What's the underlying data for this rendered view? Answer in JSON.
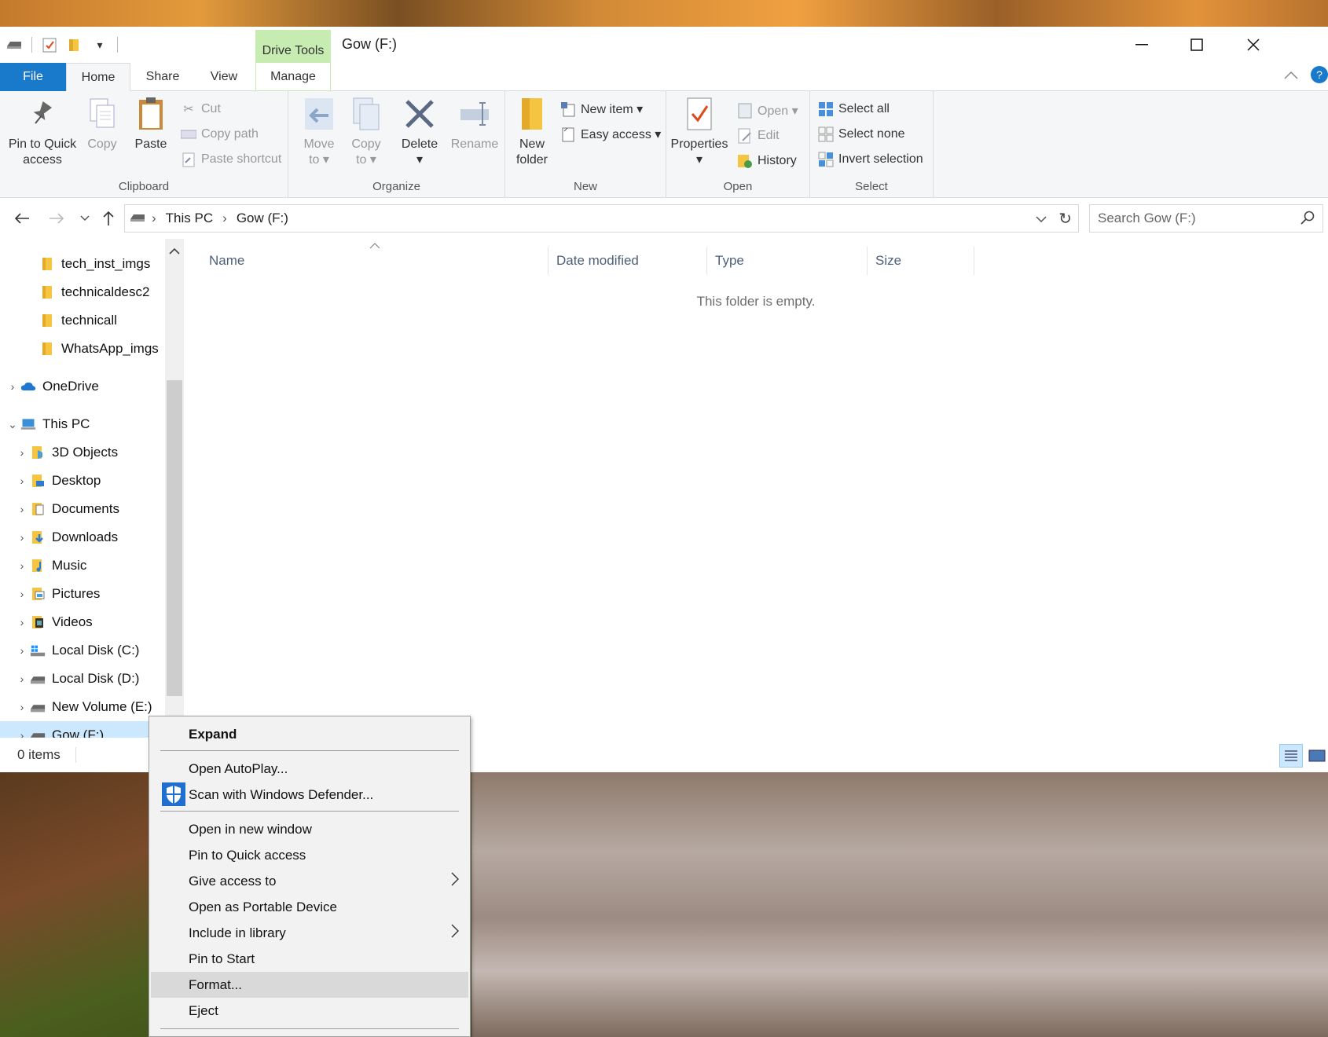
{
  "window": {
    "title": "Gow (F:)",
    "drive_tools_label": "Drive Tools",
    "controls": {
      "minimize": "—",
      "maximize": "☐",
      "close": "✕"
    }
  },
  "tabs": {
    "file": "File",
    "home": "Home",
    "share": "Share",
    "view": "View",
    "manage": "Manage"
  },
  "ribbon": {
    "clipboard": {
      "label": "Clipboard",
      "pin_line1": "Pin to Quick",
      "pin_line2": "access",
      "copy": "Copy",
      "paste": "Paste",
      "cut": "Cut",
      "copy_path": "Copy path",
      "paste_shortcut": "Paste shortcut"
    },
    "organize": {
      "label": "Organize",
      "move_line1": "Move",
      "move_line2": "to ▾",
      "copy_line1": "Copy",
      "copy_line2": "to ▾",
      "delete": "Delete",
      "delete_arrow": "▾",
      "rename": "Rename"
    },
    "new": {
      "label": "New",
      "new_folder_line1": "New",
      "new_folder_line2": "folder",
      "new_item": "New item ▾",
      "easy_access": "Easy access ▾"
    },
    "open": {
      "label": "Open",
      "properties": "Properties",
      "properties_arrow": "▾",
      "open": "Open ▾",
      "edit": "Edit",
      "history": "History"
    },
    "select": {
      "label": "Select",
      "select_all": "Select all",
      "select_none": "Select none",
      "invert": "Invert selection"
    }
  },
  "address": {
    "crumbs": [
      "This PC",
      "Gow (F:)"
    ],
    "search_placeholder": "Search Gow (F:)"
  },
  "nav": {
    "items": [
      {
        "label": "tech_inst_imgs"
      },
      {
        "label": "technicaldesc2"
      },
      {
        "label": "technicall"
      },
      {
        "label": "WhatsApp_imgs"
      },
      {
        "label": "OneDrive"
      },
      {
        "label": "This PC"
      },
      {
        "label": "3D Objects"
      },
      {
        "label": "Desktop"
      },
      {
        "label": "Documents"
      },
      {
        "label": "Downloads"
      },
      {
        "label": "Music"
      },
      {
        "label": "Pictures"
      },
      {
        "label": "Videos"
      },
      {
        "label": "Local Disk (C:)"
      },
      {
        "label": "Local Disk (D:)"
      },
      {
        "label": "New Volume (E:)"
      },
      {
        "label": "Gow (F:)"
      }
    ]
  },
  "columns": {
    "name": "Name",
    "date_modified": "Date modified",
    "type": "Type",
    "size": "Size"
  },
  "empty_message": "This folder is empty.",
  "status": {
    "items": "0 items"
  },
  "context_menu": {
    "expand": "Expand",
    "open_autoplay": "Open AutoPlay...",
    "scan_defender": "Scan with Windows Defender...",
    "open_new_window": "Open in new window",
    "pin_quick_access": "Pin to Quick access",
    "give_access": "Give access to",
    "open_portable": "Open as Portable Device",
    "include_library": "Include in library",
    "pin_start": "Pin to Start",
    "format": "Format...",
    "eject": "Eject"
  },
  "colors": {
    "accent": "#1979ca",
    "drive_tools": "#c7ecb1",
    "selection": "#cce8ff"
  }
}
